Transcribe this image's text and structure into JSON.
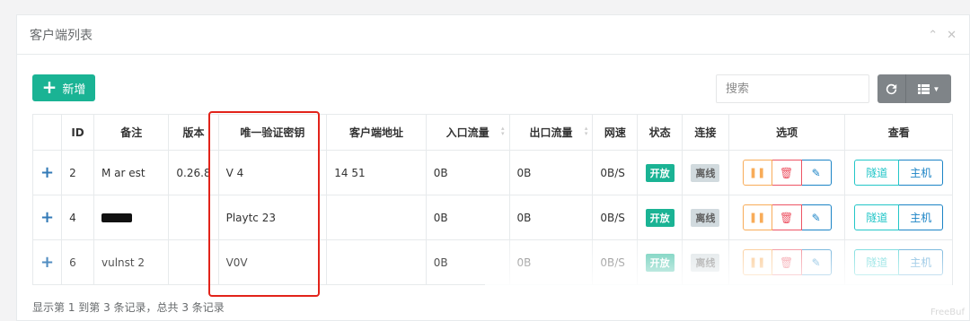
{
  "panel": {
    "title": "客户端列表",
    "collapse_icon": "chevron-up-icon",
    "close_icon": "close-icon"
  },
  "toolbar": {
    "add_label": "新增",
    "search_placeholder": "搜索",
    "refresh_icon": "refresh-icon",
    "columns_icon": "list-icon"
  },
  "table": {
    "headers": [
      "",
      "ID",
      "备注",
      "版本",
      "唯一验证密钥",
      "客户端地址",
      "入口流量",
      "出口流量",
      "网速",
      "状态",
      "连接",
      "选项",
      "查看"
    ],
    "rows": [
      {
        "id": "2",
        "remark": "M    ar  est",
        "version": "0.26.8",
        "key": "V      4",
        "address": "14       51",
        "in_flow": "0B",
        "out_flow": "0B",
        "speed": "0B/S",
        "status": "开放",
        "conn": "离线",
        "tunnel": "隧道",
        "host": "主机"
      },
      {
        "id": "4",
        "remark": "",
        "version": "",
        "key": "Playtc    23",
        "address": "",
        "in_flow": "0B",
        "out_flow": "0B",
        "speed": "0B/S",
        "status": "开放",
        "conn": "离线",
        "tunnel": "隧道",
        "host": "主机"
      },
      {
        "id": "6",
        "remark": "vulnst  2",
        "version": "",
        "key": "V0V     ",
        "address": "",
        "in_flow": "0B",
        "out_flow": "0B",
        "speed": "0B/S",
        "status": "开放",
        "conn": "离线",
        "tunnel": "隧道",
        "host": "主机"
      }
    ]
  },
  "footer": {
    "summary": "显示第 1 到第 3 条记录，总共 3 条记录"
  },
  "watermark": "FreeBuf",
  "colors": {
    "primary": "#1ab394",
    "warning": "#f8ac59",
    "danger": "#ed5565",
    "info": "#1c84c6",
    "highlight": "#e2231a"
  }
}
